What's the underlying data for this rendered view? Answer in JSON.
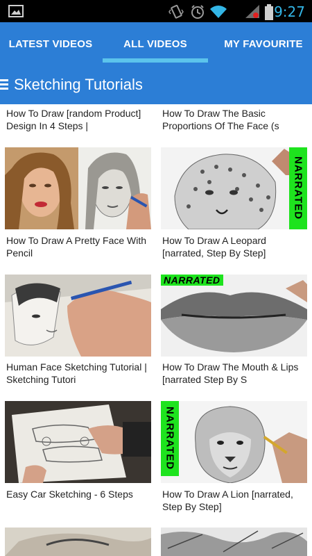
{
  "status_bar": {
    "time": "9:27",
    "icons": [
      "picture-notification-icon",
      "vibrate-icon",
      "alarm-clock-icon",
      "wifi-icon",
      "signal-icon",
      "battery-icon"
    ],
    "time_color": "#33b5e5"
  },
  "tabs": [
    {
      "label": "LATEST VIDEOS"
    },
    {
      "label": "ALL VIDEOS",
      "selected": true
    },
    {
      "label": "MY FAVOURITE"
    }
  ],
  "toolbar": {
    "title": "Sketching Tutorials",
    "menu_icon": "hamburger-menu-icon"
  },
  "colors": {
    "primary": "#2c7ed6",
    "indicator": "#5cc4ec",
    "badge": "#1ee31e"
  },
  "videos": [
    {
      "title": "How To Draw [random Product] Design In 4 Steps |"
    },
    {
      "title": "How To Draw The Basic Proportions Of The Face (s"
    },
    {
      "title": "How To Draw A Pretty Face With Pencil"
    },
    {
      "title": "How To Draw A Leopard [narrated, Step By Step]",
      "badge": "NARRATED"
    },
    {
      "title": "Human Face Sketching Tutorial | Sketching Tutori"
    },
    {
      "title": "How To Draw The Mouth & Lips [narrated Step By S",
      "badge": "NARRATED"
    },
    {
      "title": "Easy Car Sketching - 6 Steps"
    },
    {
      "title": "How To Draw A Lion [narrated, Step By Step]",
      "badge": "NARRATED"
    }
  ]
}
